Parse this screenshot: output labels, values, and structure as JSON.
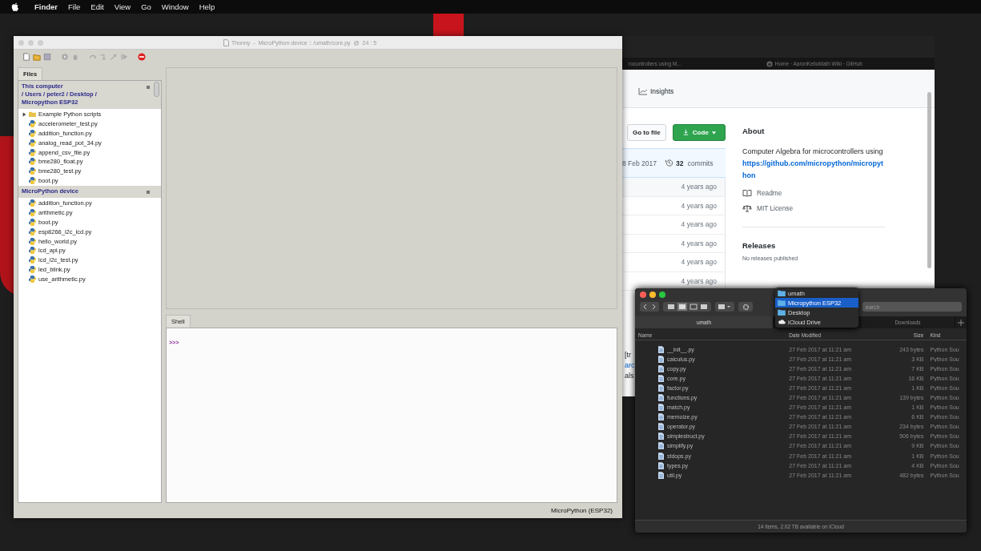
{
  "menu_bar": {
    "app": "Finder",
    "items": [
      "File",
      "Edit",
      "View",
      "Go",
      "Window",
      "Help"
    ]
  },
  "thonny": {
    "title": "Thonny  -  MicroPython device :: /umath/core.py  @  24 : 5",
    "files_tab": "Files",
    "sections": [
      {
        "title": "This computer",
        "path": [
          "/ Users / peter2 / Desktop /",
          "Micropython ESP32"
        ],
        "items": [
          {
            "kind": "folder",
            "name": "Example Python scripts",
            "expanded": false
          },
          {
            "kind": "file",
            "name": "accelerometer_test.py"
          },
          {
            "kind": "file",
            "name": "addition_function.py"
          },
          {
            "kind": "file",
            "name": "analog_read_pot_34.py"
          },
          {
            "kind": "file",
            "name": "append_csv_file.py"
          },
          {
            "kind": "file",
            "name": "bme280_float.py"
          },
          {
            "kind": "file",
            "name": "bme280_test.py"
          },
          {
            "kind": "file",
            "name": "boot.py"
          }
        ]
      },
      {
        "title": "MicroPython device",
        "items": [
          {
            "kind": "file",
            "name": "addition_function.py"
          },
          {
            "kind": "file",
            "name": "arithmetic.py"
          },
          {
            "kind": "file",
            "name": "boot.py"
          },
          {
            "kind": "file",
            "name": "esp8266_i2c_lcd.py"
          },
          {
            "kind": "file",
            "name": "hello_world.py"
          },
          {
            "kind": "file",
            "name": "lcd_api.py"
          },
          {
            "kind": "file",
            "name": "lcd_i2c_test.py"
          },
          {
            "kind": "file",
            "name": "led_blink.py"
          },
          {
            "kind": "file",
            "name": "use_arithmetic.py"
          }
        ]
      }
    ],
    "shell_tab": "Shell",
    "prompt": ">>>",
    "status": "MicroPython (ESP32)"
  },
  "browser": {
    "tabs": [
      "rocontrollers using M...",
      "Home · AaronKeliuMath Wiki · GitHub"
    ],
    "nav": "Insights",
    "go_to_file": "Go to file",
    "code_button": "Code",
    "commit_date": "8 Feb 2017",
    "commit_count": "32",
    "commit_label": "commits",
    "row_ages": [
      "4 years ago",
      "4 years ago",
      "4 years ago",
      "4 years ago",
      "4 years ago",
      "4 years ago"
    ],
    "about": {
      "heading": "About",
      "description": "Computer Algebra for microcontrollers using",
      "link": "https://github.com/micropython/micropython",
      "readme": "Readme",
      "license": "MIT License",
      "releases": "Releases",
      "releases_note": "No releases published"
    },
    "fragments": [
      {
        "kind": "text",
        "text": "[tr"
      },
      {
        "kind": "link",
        "text": "arc"
      },
      {
        "kind": "text",
        "text": "als"
      }
    ]
  },
  "finder": {
    "search": {
      "placeholder": "earch"
    },
    "tabs": [
      {
        "label": "umath",
        "selected": true
      },
      {
        "label": "Downloads",
        "selected": false
      }
    ],
    "columns": [
      "Name",
      "Date Modified",
      "Size",
      "Kind"
    ],
    "rows": [
      [
        "__init__.py",
        "27 Feb 2017 at 11:21 am",
        "243 bytes",
        "Python Sou"
      ],
      [
        "calculus.py",
        "27 Feb 2017 at 11:21 am",
        "3 KB",
        "Python Sou"
      ],
      [
        "copy.py",
        "27 Feb 2017 at 11:21 am",
        "7 KB",
        "Python Sou"
      ],
      [
        "core.py",
        "27 Feb 2017 at 11:21 am",
        "16 KB",
        "Python Sou"
      ],
      [
        "factor.py",
        "27 Feb 2017 at 11:21 am",
        "1 KB",
        "Python Sou"
      ],
      [
        "functions.py",
        "27 Feb 2017 at 11:21 am",
        "139 bytes",
        "Python Sou"
      ],
      [
        "match.py",
        "27 Feb 2017 at 11:21 am",
        "1 KB",
        "Python Sou"
      ],
      [
        "memoize.py",
        "27 Feb 2017 at 11:21 am",
        "6 KB",
        "Python Sou"
      ],
      [
        "operator.py",
        "27 Feb 2017 at 11:21 am",
        "234 bytes",
        "Python Sou"
      ],
      [
        "simplestruct.py",
        "27 Feb 2017 at 11:21 am",
        "506 bytes",
        "Python Sou"
      ],
      [
        "simplify.py",
        "27 Feb 2017 at 11:21 am",
        "9 KB",
        "Python Sou"
      ],
      [
        "stdops.py",
        "27 Feb 2017 at 11:21 am",
        "1 KB",
        "Python Sou"
      ],
      [
        "types.py",
        "27 Feb 2017 at 11:21 am",
        "4 KB",
        "Python Sou"
      ],
      [
        "util.py",
        "27 Feb 2017 at 11:21 am",
        "482 bytes",
        "Python Sou"
      ]
    ],
    "footer": "14 items, 2.02 TB available on iCloud",
    "path_menu": [
      {
        "kind": "folder",
        "label": "umath",
        "selected": false
      },
      {
        "kind": "folder",
        "label": "Micropython ESP32",
        "selected": true
      },
      {
        "kind": "folder",
        "label": "Desktop",
        "selected": false
      },
      {
        "kind": "cloud",
        "label": "iCloud Drive",
        "selected": false
      }
    ]
  }
}
